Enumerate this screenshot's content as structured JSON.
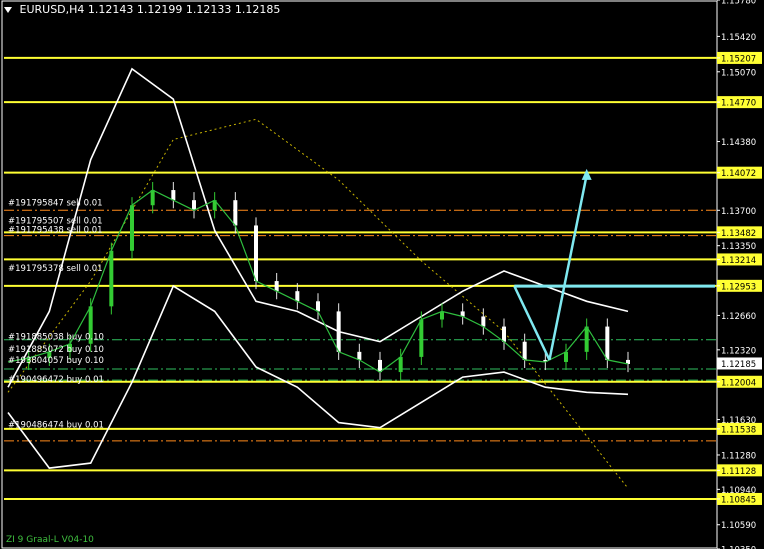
{
  "header": {
    "symbol": "EURUSD,H4",
    "ohlc": "1.12143 1.12199 1.12133 1.12185"
  },
  "footer_label": "ZI 9 Graal-L  V04-10",
  "chart_data": {
    "type": "line",
    "symbol": "EURUSD",
    "timeframe": "H4",
    "current_price": 1.12185,
    "ylim": [
      1.1035,
      1.1578
    ],
    "price_axis_ticks": [
      1.1578,
      1.1542,
      1.15207,
      1.1507,
      1.1477,
      1.1438,
      1.14072,
      1.137,
      1.13482,
      1.1335,
      1.13214,
      1.12953,
      1.1266,
      1.1232,
      1.12185,
      1.12004,
      1.1163,
      1.11538,
      1.1128,
      1.11128,
      1.1094,
      1.10845,
      1.1059,
      1.1035
    ],
    "tick_labels": [
      "1.15780",
      "1.15420",
      "1.15207",
      "1.15070",
      "1.14770",
      "1.14380",
      "1.14072",
      "1.13700",
      "1.13482",
      "1.13350",
      "1.13214",
      "1.12953",
      "1.12660",
      "1.12320",
      "1.12185",
      "1.12004",
      "1.11630",
      "1.11538",
      "1.11280",
      "1.11128",
      "1.10940",
      "1.10845",
      "1.10590",
      "1.10350"
    ],
    "horizontal_levels": [
      1.15207,
      1.1477,
      1.14072,
      1.13482,
      1.13214,
      1.12953,
      1.12004,
      1.11538,
      1.11128,
      1.10845
    ],
    "highlighted_levels": [
      "1.15207",
      "1.14770",
      "1.14072",
      "1.13482",
      "1.13214",
      "1.12953",
      "1.12004",
      "1.11538",
      "1.11128",
      "1.10845"
    ],
    "dashdot_levels": [
      1.137,
      1.1345,
      1.1242,
      1.1213,
      1.1202,
      1.1142
    ],
    "orders": [
      {
        "label": "#191795847 sell 0.01",
        "price": 1.1373
      },
      {
        "label": "#191795507 sell 0.01",
        "price": 1.1355
      },
      {
        "label": "#191795438 sell 0.01",
        "price": 1.1346
      },
      {
        "label": "#191795378 sell 0.01",
        "price": 1.1308
      },
      {
        "label": "#191885038 buy 0.10",
        "price": 1.124
      },
      {
        "label": "#191885072 buy 0.10",
        "price": 1.1228
      },
      {
        "label": "#193804057 buy 0.10",
        "price": 1.1217
      },
      {
        "label": "#190496472 buy 0.01",
        "price": 1.1198
      },
      {
        "label": "#190486474 buy 0.01",
        "price": 1.1153
      }
    ],
    "close_series": {
      "x": [
        0,
        10,
        20,
        30,
        40,
        50,
        60,
        70,
        80,
        90,
        100,
        110,
        120,
        130,
        140,
        150,
        160,
        170,
        180,
        190,
        200,
        210,
        220,
        230,
        240,
        250,
        260,
        270,
        280,
        290,
        300
      ],
      "y": [
        1.122,
        1.1224,
        1.123,
        1.1238,
        1.1275,
        1.133,
        1.1375,
        1.139,
        1.138,
        1.137,
        1.138,
        1.1355,
        1.13,
        1.129,
        1.128,
        1.127,
        1.123,
        1.1222,
        1.121,
        1.1225,
        1.1262,
        1.127,
        1.1265,
        1.1255,
        1.124,
        1.1222,
        1.122,
        1.123,
        1.1255,
        1.1222,
        1.1218
      ]
    },
    "upper_envelope": {
      "x": [
        0,
        20,
        40,
        60,
        80,
        100,
        120,
        140,
        160,
        180,
        200,
        220,
        240,
        260,
        280,
        300
      ],
      "y": [
        1.1195,
        1.127,
        1.142,
        1.151,
        1.148,
        1.135,
        1.128,
        1.127,
        1.125,
        1.124,
        1.1265,
        1.129,
        1.131,
        1.1295,
        1.128,
        1.127
      ]
    },
    "lower_envelope": {
      "x": [
        0,
        20,
        40,
        60,
        80,
        100,
        120,
        140,
        160,
        180,
        200,
        220,
        240,
        260,
        280,
        300
      ],
      "y": [
        1.117,
        1.1115,
        1.112,
        1.12,
        1.1295,
        1.127,
        1.1215,
        1.1195,
        1.116,
        1.1155,
        1.118,
        1.1205,
        1.121,
        1.1195,
        1.119,
        1.1188
      ]
    },
    "trend_dotted": {
      "x": [
        0,
        40,
        80,
        120,
        160,
        200,
        240,
        300
      ],
      "y": [
        1.119,
        1.13,
        1.144,
        1.146,
        1.14,
        1.132,
        1.125,
        1.1095
      ]
    },
    "arrow_down": {
      "from": [
        245,
        1.1295
      ],
      "to": [
        262,
        1.1222
      ]
    },
    "arrow_up": {
      "from": [
        262,
        1.1222
      ],
      "to": [
        280,
        1.1405
      ]
    },
    "arrow_color": "#7fe8f0",
    "level_color": "#ffff33",
    "axis_bg_color": "#ffff33"
  }
}
